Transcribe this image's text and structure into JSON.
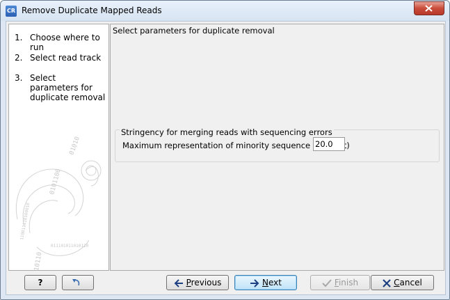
{
  "window": {
    "title": "Remove Duplicate Mapped Reads",
    "icon_text": "CR"
  },
  "steps": [
    {
      "num": "1.",
      "label": "Choose where to run"
    },
    {
      "num": "2.",
      "label": "Select read track"
    },
    {
      "num": "3.",
      "label": "Select parameters for duplicate removal"
    }
  ],
  "main": {
    "title": "Select parameters for duplicate removal",
    "group_title": "Stringency for merging reads with sequencing errors",
    "field_label": "Maximum representation of minority sequence (percent)",
    "field_value": "20.0"
  },
  "buttons": {
    "help": "?",
    "previous_u": "P",
    "previous_rest": "revious",
    "next_u": "N",
    "next_rest": "ext",
    "finish_u": "F",
    "finish_rest": "inish",
    "cancel_u": "C",
    "cancel_rest": "ancel"
  },
  "colors": {
    "accent": "#3c7fb1",
    "close": "#c94b3a"
  }
}
